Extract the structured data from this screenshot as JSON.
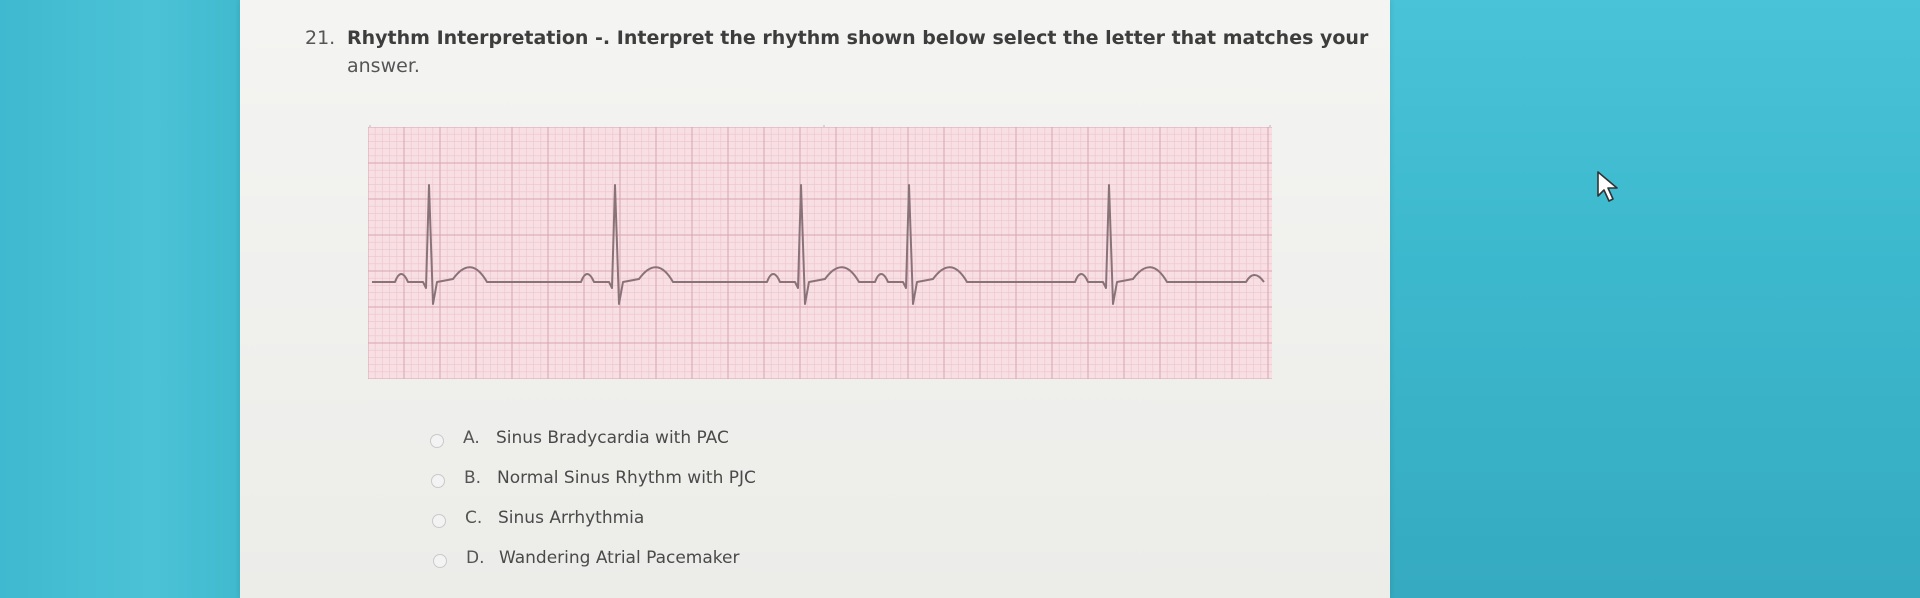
{
  "question": {
    "number": "21.",
    "text_line1": "Rhythm Interpretation -. Interpret the rhythm shown below select the letter that matches your",
    "text_line2": "answer."
  },
  "rhythm_strip": {
    "paper_color": "#f7dfe4",
    "trace_color": "#8a7378"
  },
  "options": [
    {
      "letter": "A.",
      "label": "Sinus Bradycardia with PAC"
    },
    {
      "letter": "B.",
      "label": "Normal Sinus Rhythm with PJC"
    },
    {
      "letter": "C.",
      "label": "Sinus Arrhythmia"
    },
    {
      "letter": "D.",
      "label": "Wandering Atrial Pacemaker"
    }
  ],
  "cursor": {
    "icon": "mouse-pointer-icon"
  }
}
